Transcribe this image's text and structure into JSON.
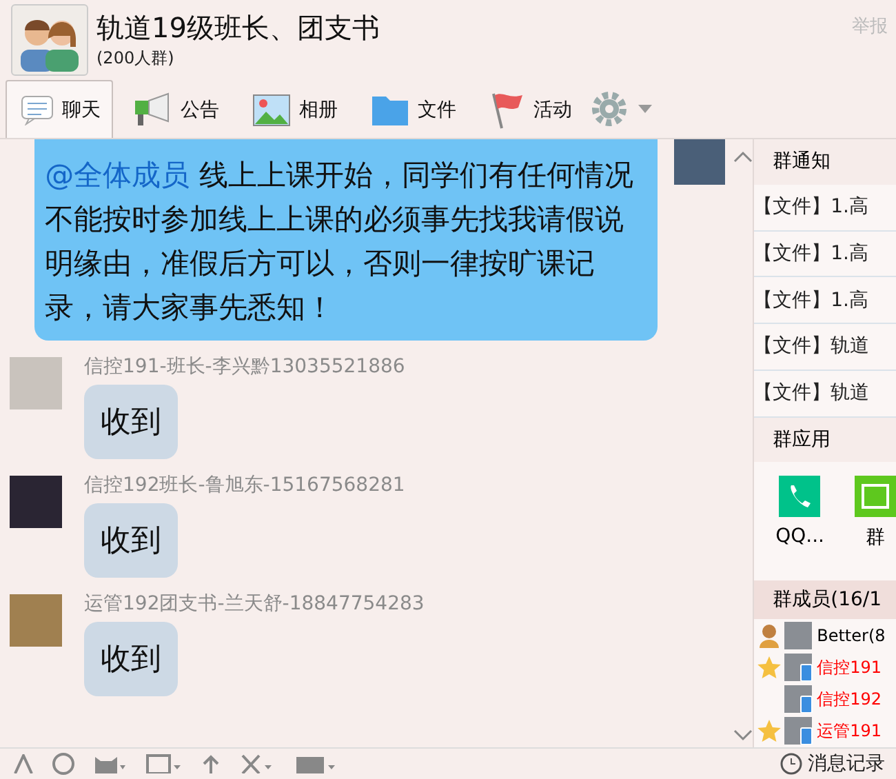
{
  "header": {
    "title": "轨道19级班长、团支书",
    "subtitle": "(200人群)",
    "report": "举报"
  },
  "tabs": [
    {
      "label": "聊天",
      "kind": "chat",
      "selected": true
    },
    {
      "label": "公告",
      "kind": "megaphone",
      "selected": false
    },
    {
      "label": "相册",
      "kind": "photo",
      "selected": false
    },
    {
      "label": "文件",
      "kind": "folder",
      "selected": false
    },
    {
      "label": "活动",
      "kind": "flag",
      "selected": false
    }
  ],
  "own_message": {
    "mention": "@全体成员",
    "text": "线上上课开始，同学们有任何情况不能按时参加线上上课的必须事先找我请假说明缘由，准假后方可以，否则一律按旷课记录，请大家事先悉知！"
  },
  "messages": [
    {
      "sender": "信控191-班长-李兴黔13035521886",
      "text": "收到"
    },
    {
      "sender": "信控192班长-鲁旭东-15167568281",
      "text": "收到"
    },
    {
      "sender": "运管192团支书-兰天舒-18847754283",
      "text": "收到"
    }
  ],
  "sidebar": {
    "notice_title": "群通知",
    "notices": [
      "【文件】1.高",
      "【文件】1.高",
      "【文件】1.高",
      "【文件】轨道",
      "【文件】轨道"
    ],
    "apps_title": "群应用",
    "apps": [
      {
        "label": "QQ...",
        "kind": "phone"
      },
      {
        "label": "群",
        "kind": "calendar"
      }
    ],
    "members_title": "群成员(16/1",
    "members": [
      {
        "name": "Better(8",
        "kind": "owner",
        "mobile": false,
        "color": "#000000"
      },
      {
        "name": "信控191",
        "kind": "admin",
        "mobile": true,
        "color": "#ff0000"
      },
      {
        "name": "信控192",
        "kind": "member",
        "mobile": true,
        "color": "#ff0000"
      },
      {
        "name": "运管191",
        "kind": "admin",
        "mobile": true,
        "color": "#ff0000"
      }
    ]
  },
  "history": "消息记录"
}
